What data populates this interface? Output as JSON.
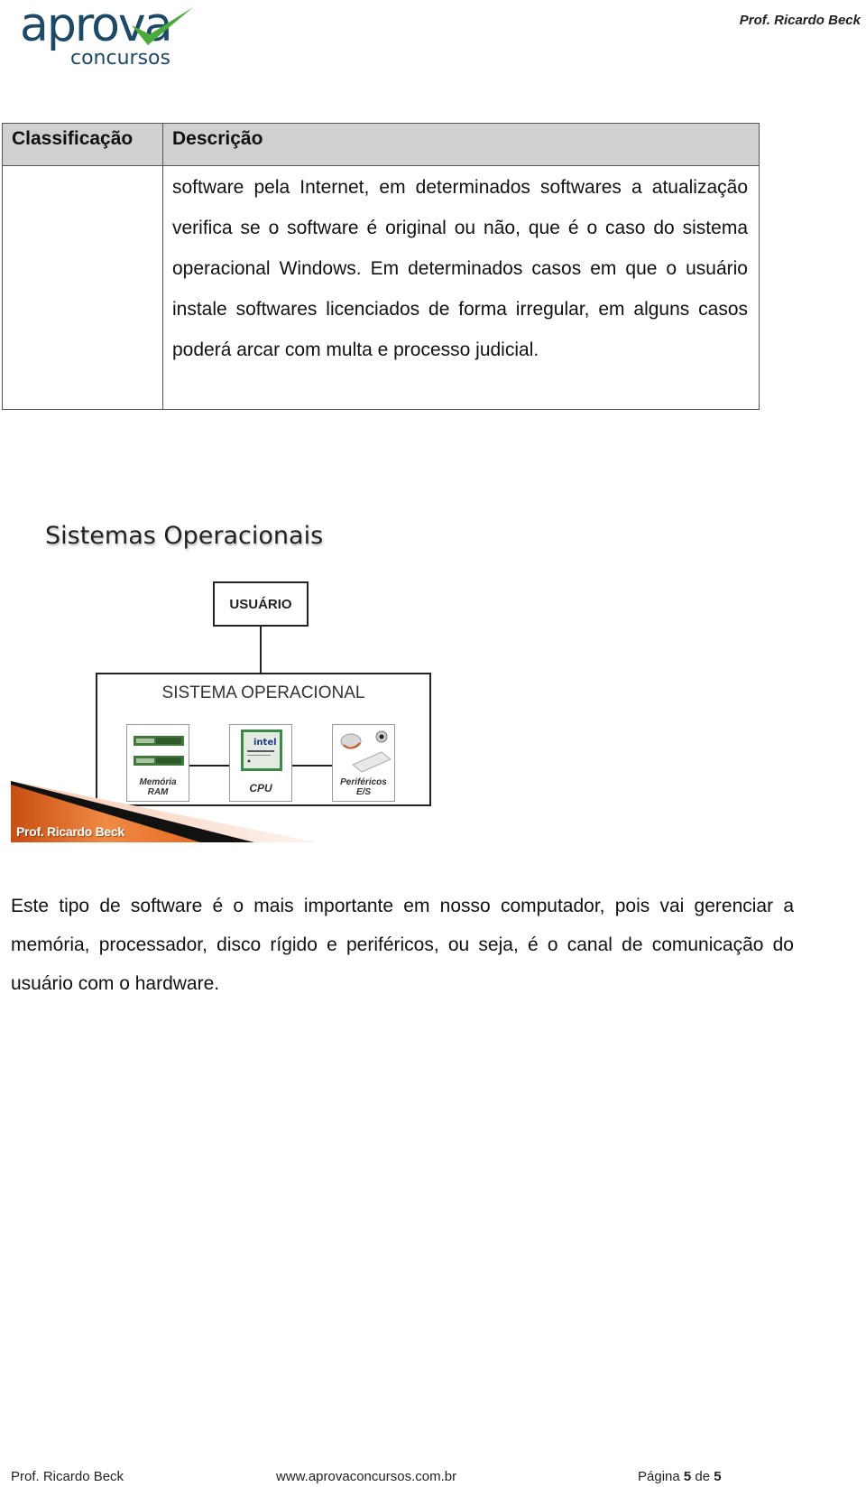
{
  "header": {
    "logo_main": "aprova",
    "logo_sub": "concursos",
    "logo_colors": {
      "text": "#1d4a66",
      "check": "#4aaa3c"
    },
    "author": "Prof. Ricardo Beck"
  },
  "table": {
    "headers": [
      "Classificação",
      "Descrição"
    ],
    "rows": [
      {
        "classificacao": "",
        "descricao": "software pela Internet, em determinados softwares a atualização verifica se o software é original ou não, que é o caso do sistema operacional Windows. Em determinados casos em que o usuário instale softwares licenciados de forma irregular, em alguns casos poderá arcar com multa e processo judicial."
      }
    ],
    "header_bg": "#d0d0d0"
  },
  "figure": {
    "title": "Sistemas Operacionais",
    "user_box": "USUÁRIO",
    "os_box": "SISTEMA OPERACIONAL",
    "components": [
      {
        "icon": "ram-memory-icon",
        "label_line1": "Memória",
        "label_line2": "RAM"
      },
      {
        "icon": "cpu-chip-icon",
        "label_line1": "CPU",
        "label_line2": ""
      },
      {
        "icon": "peripherals-icon",
        "label_line1": "Periféricos",
        "label_line2": "E/S"
      }
    ],
    "cpu_brand": "intel",
    "banner_text": "Prof. Ricardo Beck",
    "banner_color": "#e0621a"
  },
  "paragraph": "Este tipo de software é o mais importante em nosso computador, pois vai gerenciar a memória, processador, disco rígido e periféricos, ou seja, é o canal de comunicação do usuário com o hardware.",
  "footer": {
    "author": "Prof. Ricardo Beck",
    "website": "www.aprovaconcursos.com.br",
    "page_prefix": "Página",
    "page_current": "5",
    "page_sep": "de",
    "page_total": "5"
  }
}
